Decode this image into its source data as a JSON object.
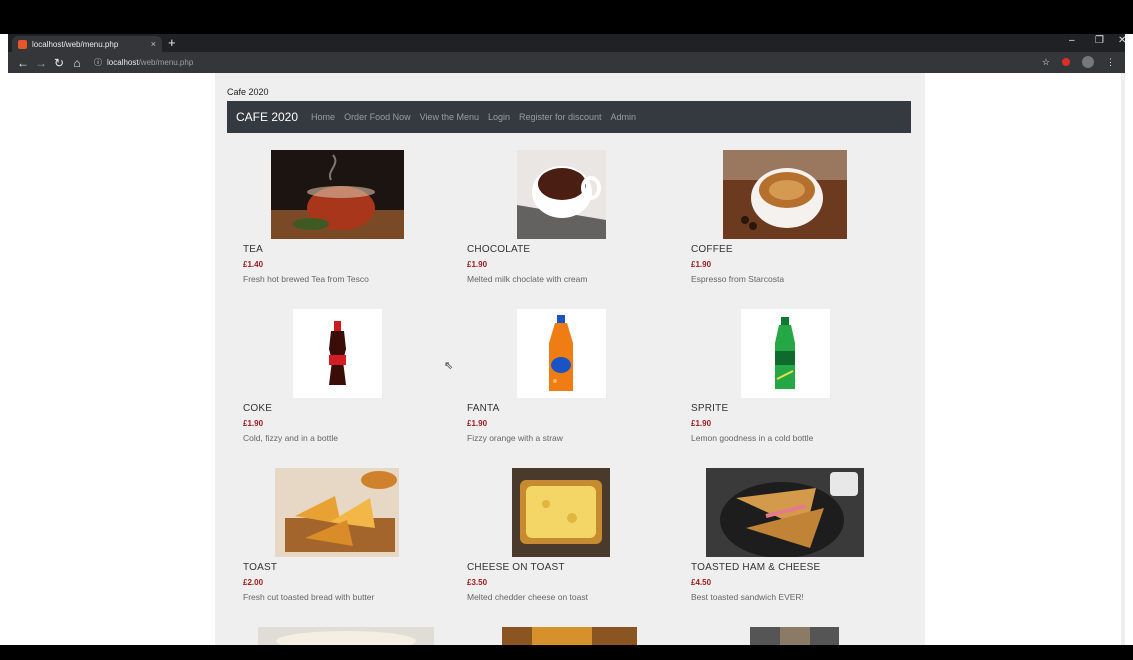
{
  "browser": {
    "tab_title": "localhost/web/menu.php",
    "tab_close": "×",
    "new_tab": "+",
    "url_host": "localhost",
    "url_path": "/web/menu.php",
    "window_controls": [
      "–",
      "❐",
      "✕"
    ]
  },
  "site": {
    "title": "Cafe 2020",
    "brand": "CAFE 2020",
    "nav": [
      "Home",
      "Order Food Now",
      "View the Menu",
      "Login",
      "Register for discount",
      "Admin"
    ]
  },
  "menu": [
    {
      "name": "TEA",
      "price": "£1.40",
      "desc": "Fresh hot brewed Tea from Tesco",
      "icon": "tea-cup-image"
    },
    {
      "name": "CHOCOLATE",
      "price": "£1.90",
      "desc": "Melted milk choclate with cream",
      "icon": "hot-chocolate-image"
    },
    {
      "name": "COFFEE",
      "price": "£1.90",
      "desc": "Espresso from Starcosta",
      "icon": "coffee-cup-image"
    },
    {
      "name": "COKE",
      "price": "£1.90",
      "desc": "Cold, fizzy and in a bottle",
      "icon": "coke-bottle-image"
    },
    {
      "name": "FANTA",
      "price": "£1.90",
      "desc": "Fizzy orange with a straw",
      "icon": "fanta-bottle-image"
    },
    {
      "name": "SPRITE",
      "price": "£1.90",
      "desc": "Lemon goodness in a cold bottle",
      "icon": "sprite-bottle-image"
    },
    {
      "name": "TOAST",
      "price": "£2.00",
      "desc": "Fresh cut toasted bread with butter",
      "icon": "toast-image"
    },
    {
      "name": "CHEESE ON TOAST",
      "price": "£3.50",
      "desc": "Melted chedder cheese on toast",
      "icon": "cheese-on-toast-image"
    },
    {
      "name": "TOASTED HAM & CHEESE",
      "price": "£4.50",
      "desc": "Best toasted sandwich EVER!",
      "icon": "toasted-sandwich-image"
    }
  ],
  "colors": {
    "navbar": "#343a40",
    "price": "#9b1b1b",
    "page_bg": "#efefef"
  }
}
